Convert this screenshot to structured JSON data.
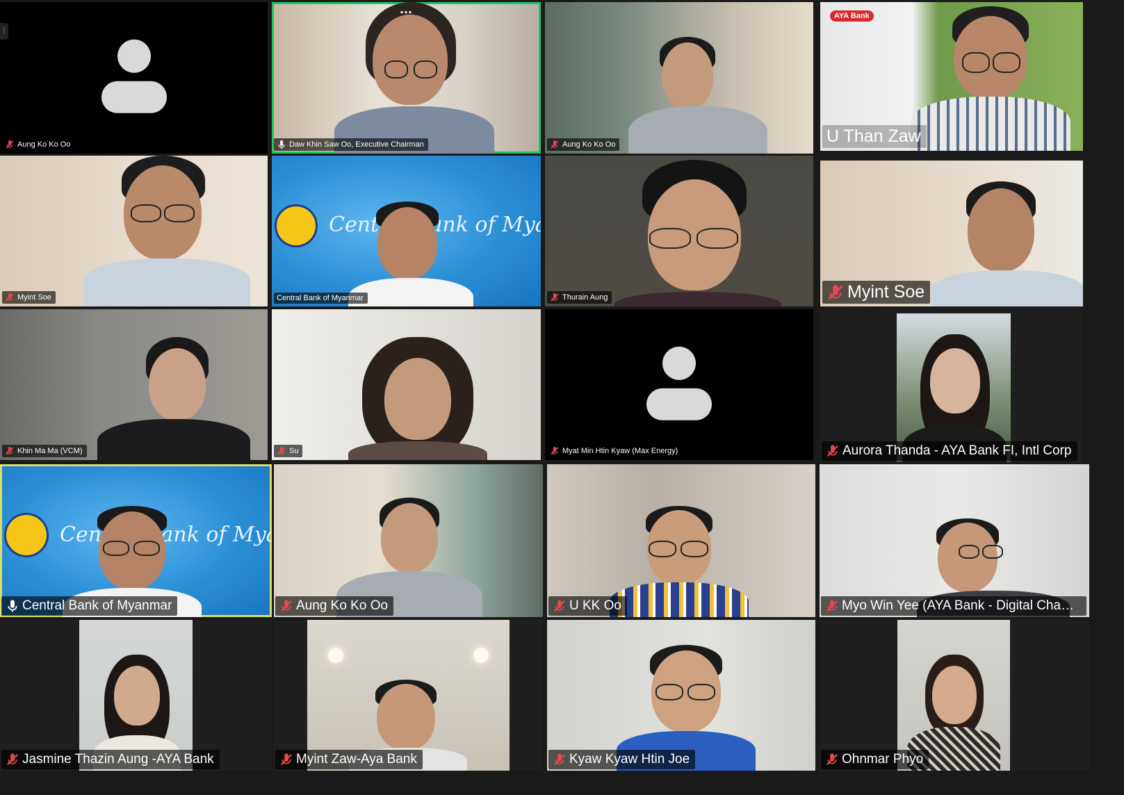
{
  "participants": [
    {
      "name": "Aung Ko Ko Oo",
      "muted": true,
      "video": false
    },
    {
      "name": "Daw Khin Saw Oo, Executive Chairman",
      "muted": false,
      "video": true,
      "speaking": true,
      "menu_icon": "more-dots-icon"
    },
    {
      "name": "Aung Ko Ko Oo",
      "muted": true,
      "video": true
    },
    {
      "name": "U Than Zaw",
      "muted": false,
      "video": true,
      "overlay_brand": "AYA Bank"
    },
    {
      "name": "Myint Soe",
      "muted": true,
      "video": true
    },
    {
      "name": "Central Bank of Myanmar",
      "muted": false,
      "video": true,
      "background_text": "Central Bank of Myanmar"
    },
    {
      "name": "Thurain Aung",
      "muted": true,
      "video": true
    },
    {
      "name": "Myint Soe",
      "muted": true,
      "video": true
    },
    {
      "name": "Khin Ma Ma (VCM)",
      "muted": true,
      "video": true
    },
    {
      "name": "Su",
      "muted": true,
      "video": true
    },
    {
      "name": "Myat Min Htin Kyaw (Max Energy)",
      "muted": true,
      "video": false
    },
    {
      "name": "Aurora Thanda - AYA Bank FI, Intl Corp",
      "muted": true,
      "video": true
    },
    {
      "name": "Central Bank of Myanmar",
      "muted": false,
      "video": true,
      "speaking": true,
      "background_text": "Central Bank of Myanmar"
    },
    {
      "name": "Aung Ko Ko Oo",
      "muted": true,
      "video": true
    },
    {
      "name": "U KK Oo",
      "muted": true,
      "video": true
    },
    {
      "name": "Myo Win Yee (AYA Bank - Digital Chann...",
      "muted": true,
      "video": true
    },
    {
      "name": "Jasmine Thazin Aung -AYA Bank",
      "muted": true,
      "video": true
    },
    {
      "name": "Myint Zaw-Aya Bank",
      "muted": true,
      "video": true
    },
    {
      "name": "Kyaw Kyaw Htin Joe",
      "muted": true,
      "video": true
    },
    {
      "name": "Ohnmar Phyo",
      "muted": true,
      "video": true
    }
  ],
  "colors": {
    "active_speaker_border": "#22c55e",
    "spotlight_border": "#d9dd6a",
    "muted_icon": "#e5484d",
    "bank_blue": "#1e88d8"
  }
}
